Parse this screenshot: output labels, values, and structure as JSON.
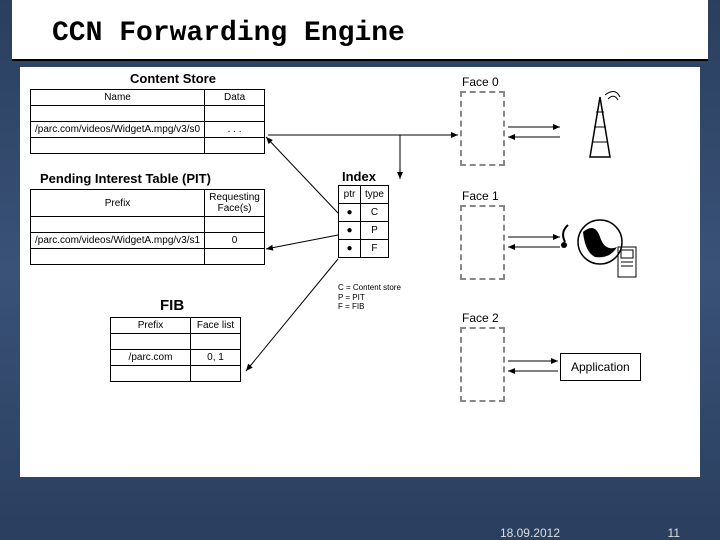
{
  "title": "CCN Forwarding Engine",
  "content_store": {
    "title": "Content Store",
    "cols": [
      "Name",
      "Data"
    ],
    "rows": [
      [
        "/parc.com/videos/WidgetA.mpg/v3/s0",
        ". . ."
      ],
      [
        "",
        ""
      ]
    ]
  },
  "pit": {
    "title": "Pending Interest Table (PIT)",
    "cols": [
      "Prefix",
      "Requesting Face(s)"
    ],
    "rows": [
      [
        "",
        ""
      ],
      [
        "/parc.com/videos/WidgetA.mpg/v3/s1",
        "0"
      ],
      [
        "",
        ""
      ]
    ]
  },
  "fib": {
    "title": "FIB",
    "cols": [
      "Prefix",
      "Face list"
    ],
    "rows": [
      [
        "",
        ""
      ],
      [
        "/parc.com",
        "0, 1"
      ],
      [
        "",
        ""
      ]
    ]
  },
  "index": {
    "title": "Index",
    "cols": [
      "ptr",
      "type"
    ],
    "rows": [
      [
        "●",
        "C"
      ],
      [
        "●",
        "P"
      ],
      [
        "●",
        "F"
      ]
    ],
    "legend": [
      "C = Content store",
      "P = PIT",
      "F = FIB"
    ]
  },
  "faces": [
    "Face 0",
    "Face 1",
    "Face 2"
  ],
  "application_label": "Application",
  "footer": {
    "date": "18.09.2012",
    "page": "11"
  }
}
